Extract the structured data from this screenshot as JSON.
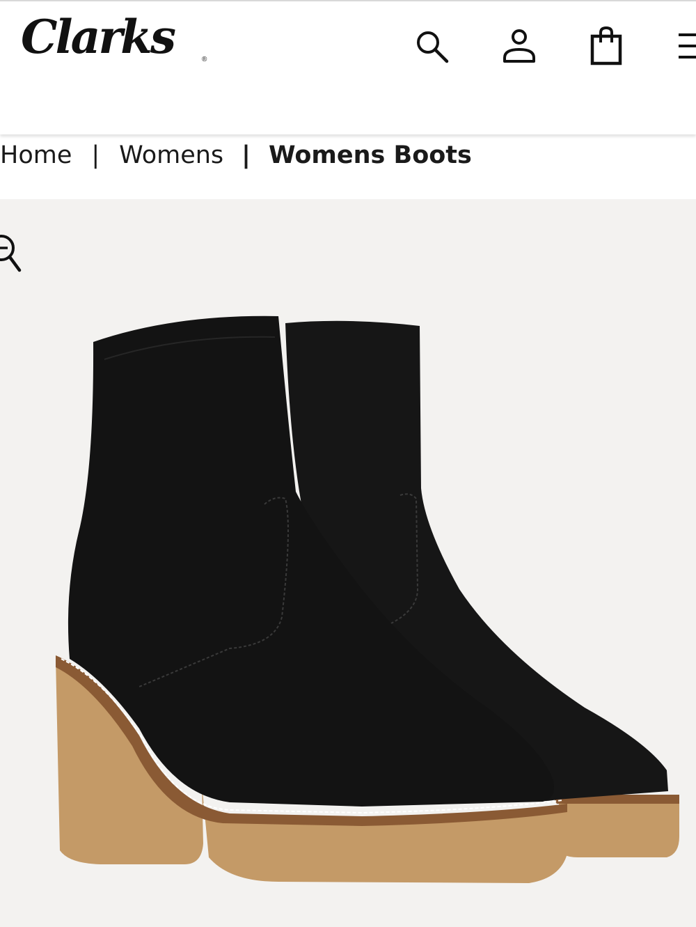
{
  "header": {
    "logo_text": "Clarks",
    "logo_reg": "®",
    "icons": [
      "search-icon",
      "account-icon",
      "shopping-bag-icon",
      "menu-icon"
    ]
  },
  "breadcrumb": {
    "items": [
      "Home",
      "Womens",
      "Womens Boots"
    ],
    "separator": "|"
  },
  "product": {
    "image_alt": "Black suede heeled ankle boots with crepe sole",
    "zoom_icon": "zoom-in-icon"
  },
  "colors": {
    "boot": "#131313",
    "sole": "#c49a67",
    "welt": "#8a5a34",
    "background": "#f3f2f0"
  }
}
